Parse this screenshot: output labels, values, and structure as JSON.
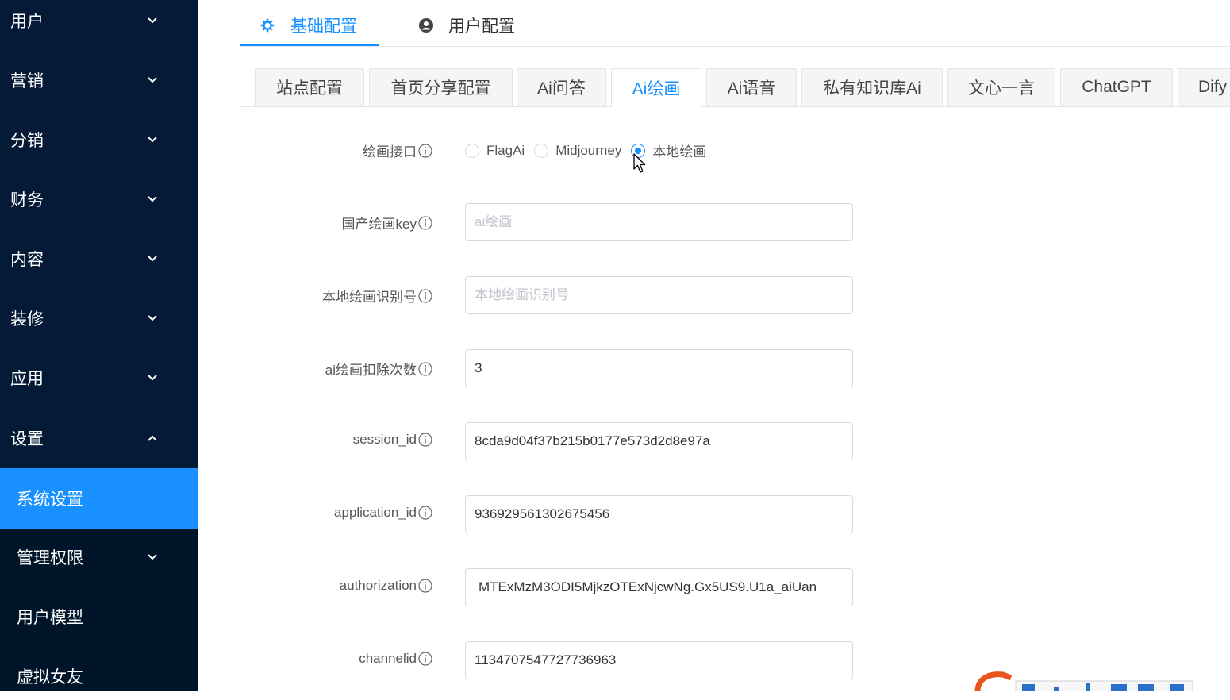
{
  "sidebar": {
    "items": [
      {
        "label": "用户",
        "chevron": "down"
      },
      {
        "label": "营销",
        "chevron": "down"
      },
      {
        "label": "分销",
        "chevron": "down"
      },
      {
        "label": "财务",
        "chevron": "down"
      },
      {
        "label": "内容",
        "chevron": "down"
      },
      {
        "label": "装修",
        "chevron": "down"
      },
      {
        "label": "应用",
        "chevron": "down"
      },
      {
        "label": "设置",
        "chevron": "up"
      }
    ],
    "subitems": [
      {
        "label": "系统设置",
        "active": true
      },
      {
        "label": "管理权限",
        "chevron": "down"
      },
      {
        "label": "用户模型"
      },
      {
        "label": "虚拟女友"
      }
    ]
  },
  "top_tabs": [
    {
      "label": "基础配置",
      "icon": "gear-icon",
      "active": true
    },
    {
      "label": "用户配置",
      "icon": "user-circle-icon",
      "active": false
    }
  ],
  "card_tabs": [
    {
      "label": "站点配置"
    },
    {
      "label": "首页分享配置"
    },
    {
      "label": "Ai问答"
    },
    {
      "label": "Ai绘画",
      "active": true
    },
    {
      "label": "Ai语音"
    },
    {
      "label": "私有知识库Ai"
    },
    {
      "label": "文心一言"
    },
    {
      "label": "ChatGPT"
    },
    {
      "label": "Dify"
    }
  ],
  "form": {
    "draw_api": {
      "label": "绘画接口",
      "options": [
        "FlagAi",
        "Midjourney",
        "本地绘画"
      ],
      "selected": "本地绘画"
    },
    "domestic_key": {
      "label": "国产绘画key",
      "value": "",
      "placeholder": "ai绘画"
    },
    "local_id": {
      "label": "本地绘画识别号",
      "value": "",
      "placeholder": "本地绘画识别号"
    },
    "deduct_count": {
      "label": "ai绘画扣除次数",
      "value": "3"
    },
    "session_id": {
      "label": "session_id",
      "value": "8cda9d04f37b215b0177e573d2d8e97a"
    },
    "application_id": {
      "label": "application_id",
      "value": "936929561302675456"
    },
    "authorization": {
      "label": "authorization",
      "value": "MTExMzM3ODI5MjkzOTExNjcwNg.Gx5US9.U1a_aiUan"
    },
    "channelid": {
      "label": "channelid",
      "value": "1134707547727736963"
    }
  },
  "colors": {
    "sidebar_bg": "#041a36",
    "sidebar_bottom_bg": "#001529",
    "accent": "#1890ff"
  }
}
